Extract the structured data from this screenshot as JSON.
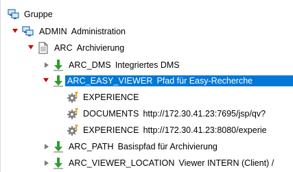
{
  "tree": {
    "root": {
      "label": "Gruppe",
      "icon": "group-icon"
    },
    "admin": {
      "key": "ADMIN",
      "desc": "Administration",
      "icon": "group-icon"
    },
    "arc": {
      "key": "ARC",
      "desc": "Archivierung",
      "icon": "document-icon"
    },
    "arc_dms": {
      "key": "ARC_DMS",
      "desc": "Integriertes DMS",
      "icon": "download-arrow-icon"
    },
    "arc_easy_viewer": {
      "key": "ARC_EASY_VIEWER",
      "desc": "Pfad für Easy-Recherche",
      "icon": "download-arrow-icon"
    },
    "experience_1": {
      "key": "EXPERIENCE",
      "desc": "",
      "icon": "gear-icon"
    },
    "documents": {
      "key": "DOCUMENTS",
      "desc": "http://172.30.41.23:7695/jsp/qv?",
      "icon": "gear-icon"
    },
    "experience_2": {
      "key": "EXPERIENCE",
      "desc": "http://172.30.41.23:8080/experie",
      "icon": "gear-icon"
    },
    "arc_path": {
      "key": "ARC_PATH",
      "desc": "Basispfad für Archivierung",
      "icon": "download-arrow-icon"
    },
    "arc_viewer_location": {
      "key": "ARC_VIEWER_LOCATION",
      "desc": "Viewer INTERN (Client) /",
      "icon": "download-arrow-icon"
    }
  },
  "colors": {
    "selection": "#0078d7",
    "expanded_toggle": "#cc0000",
    "collapsed_toggle": "#7a7a7a",
    "arrow_green": "#2e9e2e",
    "group_blue": "#2a6fb3",
    "gear_gray": "#7c7c7c",
    "gear_orange": "#e8a020"
  }
}
